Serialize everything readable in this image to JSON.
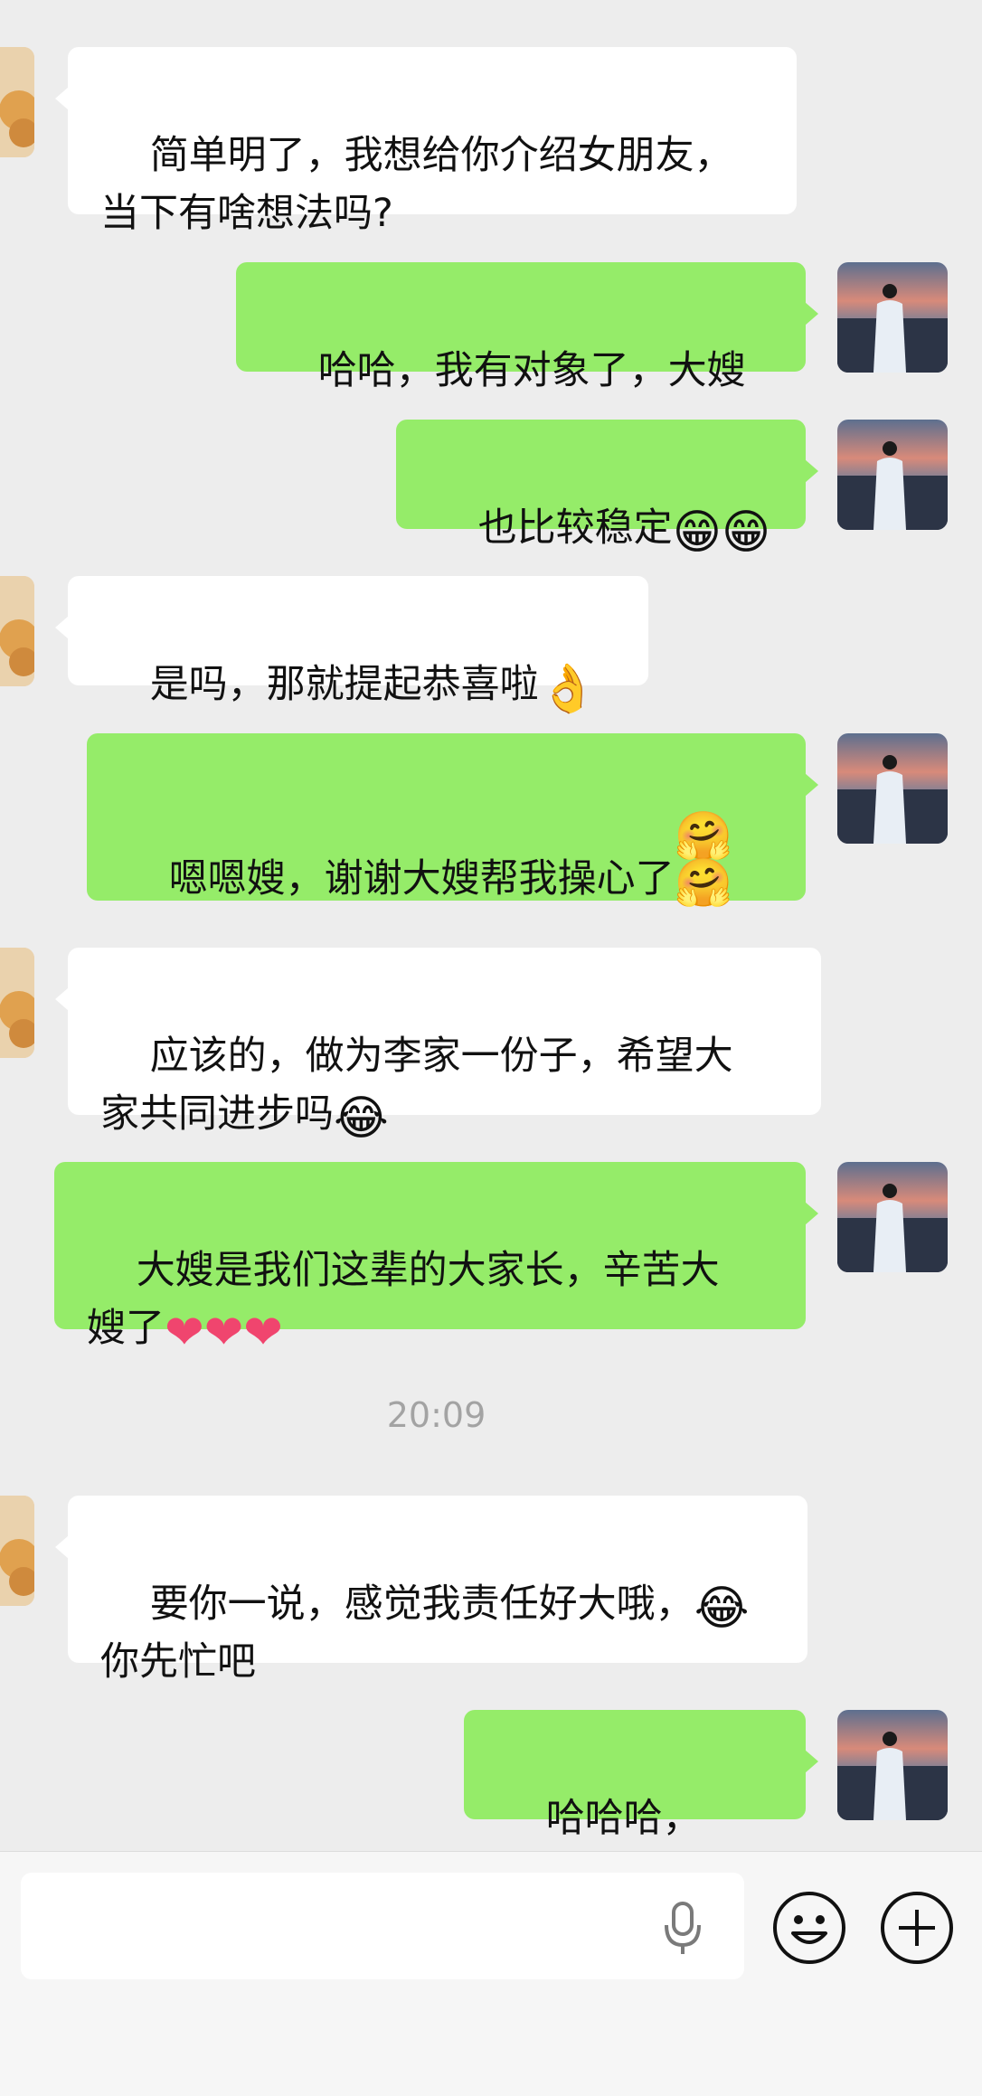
{
  "messages": [
    {
      "side": "in",
      "text": "简单明了，我想给你介绍女朋友，\n当下有啥想法吗?",
      "emoji": ""
    },
    {
      "side": "out",
      "text": "哈哈，我有对象了，大嫂",
      "emoji": ""
    },
    {
      "side": "out",
      "text": "也比较稳定",
      "emoji": "😁😁"
    },
    {
      "side": "in",
      "text": "是吗，那就提起恭喜啦",
      "emoji": "👌"
    },
    {
      "side": "out",
      "text": "嗯嗯嫂，谢谢大嫂帮我操心了",
      "emoji": "🤗\n🤗"
    },
    {
      "side": "in",
      "text": "应该的，做为李家一份子，希望大\n家共同进步吗",
      "emoji": "😂"
    },
    {
      "side": "out",
      "text": "大嫂是我们这辈的大家长，辛苦大\n嫂了",
      "emoji": "❤❤❤"
    },
    {
      "side": "in",
      "text": "要你一说，感觉我责任好大哦，",
      "emoji": "😂",
      "tail": "\n你先忙吧"
    },
    {
      "side": "out",
      "text": "哈哈哈，",
      "emoji": "👍👍"
    }
  ],
  "timestamp": "20:09",
  "input": {
    "placeholder": "",
    "mic_icon": "microphone-icon",
    "emoji_icon": "smiley-icon",
    "plus_icon": "plus-icon"
  },
  "colors": {
    "background": "#ededed",
    "incoming_bubble": "#ffffff",
    "outgoing_bubble": "#95ec69",
    "timestamp": "#a3a3a3"
  }
}
